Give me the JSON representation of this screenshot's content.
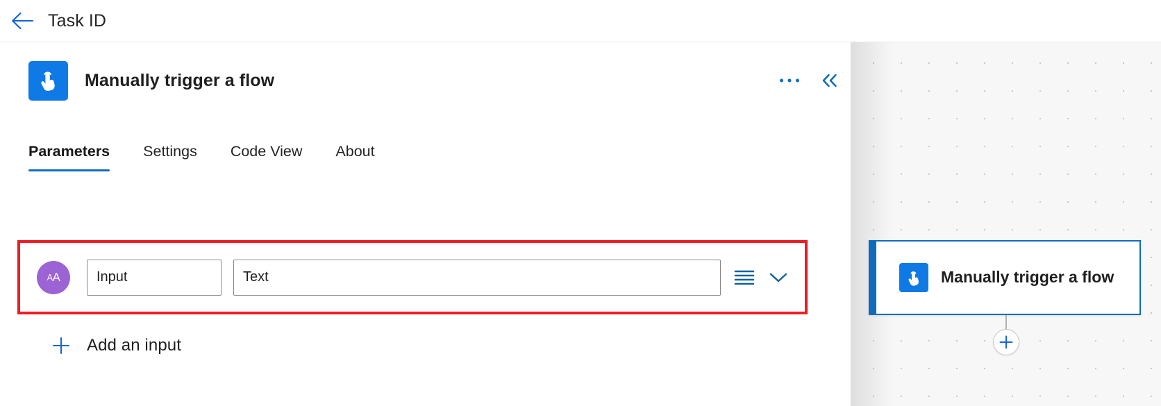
{
  "topbar": {
    "back_icon": "arrow-left-icon",
    "title": "Task ID"
  },
  "panel": {
    "icon": "manual-trigger-tap-icon",
    "title": "Manually trigger a flow",
    "more_icon": "ellipsis-icon",
    "collapse_icon": "double-chevron-left-icon",
    "tabs": [
      {
        "label": "Parameters",
        "active": true
      },
      {
        "label": "Settings",
        "active": false
      },
      {
        "label": "Code View",
        "active": false
      },
      {
        "label": "About",
        "active": false
      }
    ],
    "parameter_row": {
      "type_badge": "aA",
      "type_badge_icon": "text-type-icon",
      "type_badge_color": "#9b63d3",
      "name_value": "Input",
      "name_placeholder": "Input",
      "value_value": "Text",
      "value_placeholder": "Text",
      "menu_icon": "hamburger-list-icon",
      "expand_icon": "chevron-down-icon",
      "highlight_color": "#ee1c25"
    },
    "add_input": {
      "icon": "plus-icon",
      "label": "Add an input"
    }
  },
  "canvas": {
    "node": {
      "icon": "manual-trigger-tap-icon",
      "title": "Manually trigger a flow",
      "accent_color": "#0f6cbd"
    },
    "add_node_icon": "plus-circle-icon"
  }
}
